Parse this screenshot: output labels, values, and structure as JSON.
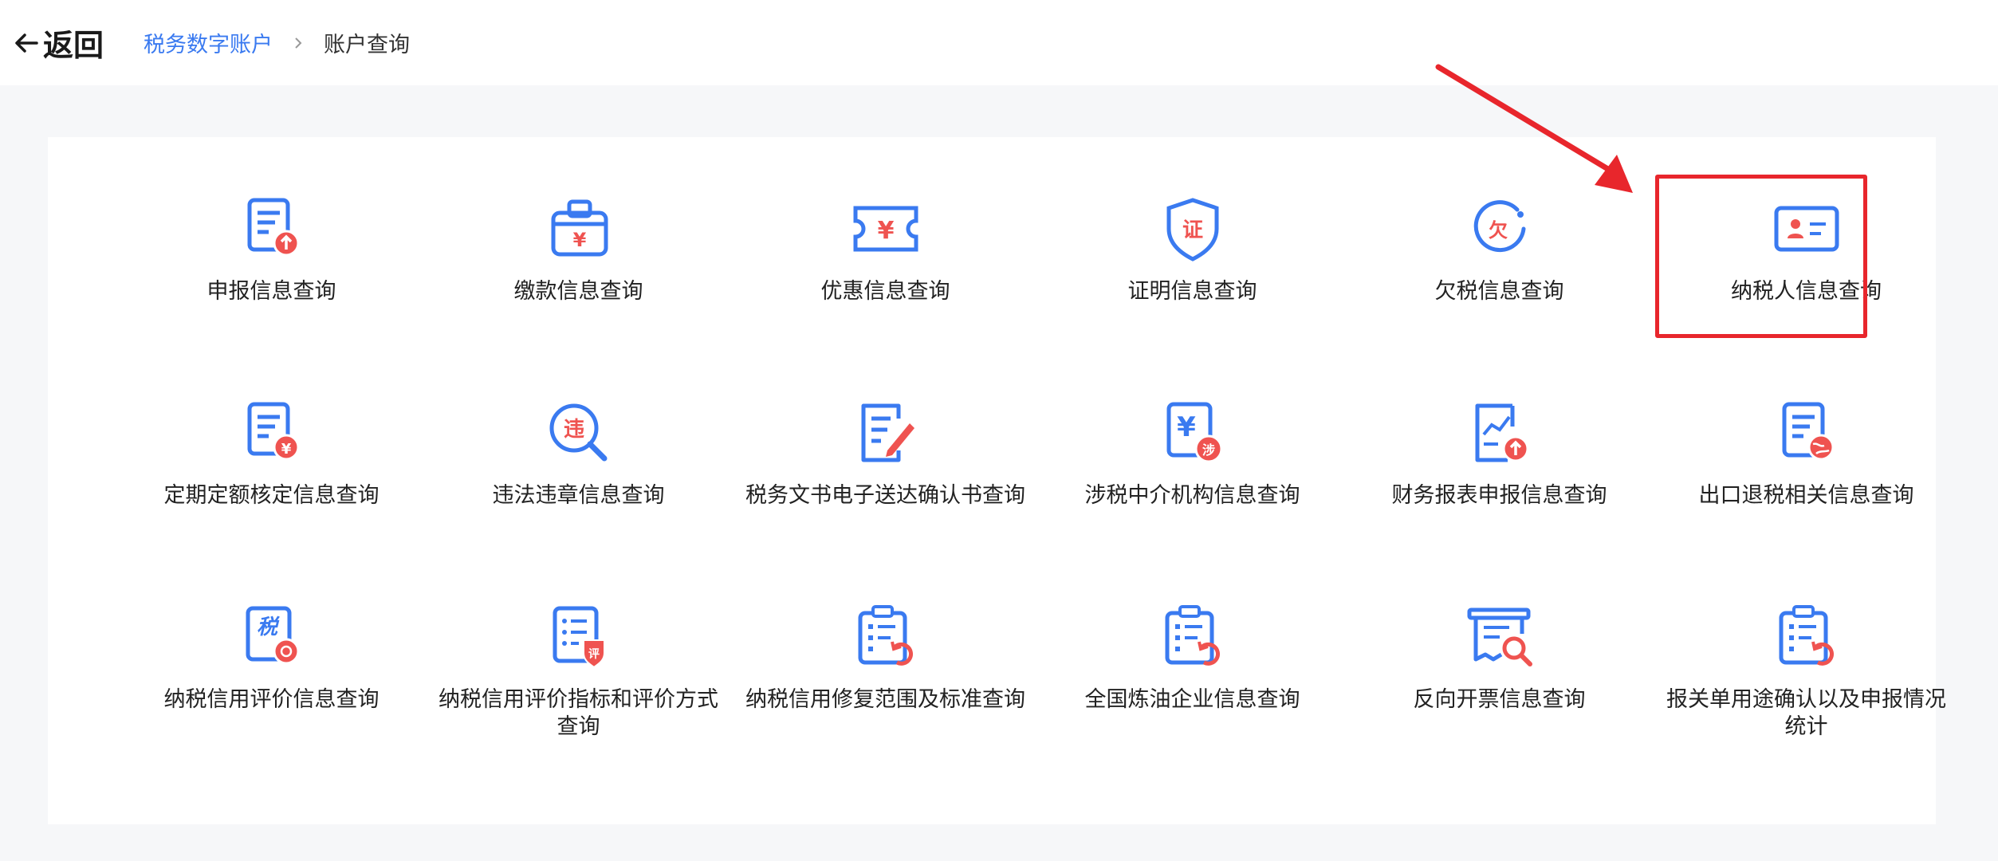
{
  "header": {
    "back_label": "返回",
    "breadcrumb": [
      {
        "label": "税务数字账户"
      },
      {
        "label": "账户查询"
      }
    ]
  },
  "colors": {
    "accent": "#3a7af0",
    "badge": "#ef5350",
    "highlight": "#e8262c"
  },
  "items": [
    {
      "label": "申报信息查询",
      "icon": "doc-upload-icon"
    },
    {
      "label": "缴款信息查询",
      "icon": "wallet-yuan-icon"
    },
    {
      "label": "优惠信息查询",
      "icon": "coupon-yuan-icon"
    },
    {
      "label": "证明信息查询",
      "icon": "certificate-shield-icon"
    },
    {
      "label": "欠税信息查询",
      "icon": "arrears-gauge-icon"
    },
    {
      "label": "纳税人信息查询",
      "icon": "id-card-icon"
    },
    {
      "label": "定期定额核定信息查询",
      "icon": "doc-yuan-icon"
    },
    {
      "label": "违法违章信息查询",
      "icon": "violation-search-icon"
    },
    {
      "label": "税务文书电子送达确认书查询",
      "icon": "doc-pen-icon"
    },
    {
      "label": "涉税中介机构信息查询",
      "icon": "agency-yuan-icon"
    },
    {
      "label": "财务报表申报信息查询",
      "icon": "report-chart-icon"
    },
    {
      "label": "出口退税相关信息查询",
      "icon": "doc-globe-icon"
    },
    {
      "label": "纳税信用评价信息查询",
      "icon": "tax-credit-icon"
    },
    {
      "label": "纳税信用评价指标和评价方式查询",
      "icon": "evaluation-doc-icon"
    },
    {
      "label": "纳税信用修复范围及标准查询",
      "icon": "clipboard-refresh-icon"
    },
    {
      "label": "全国炼油企业信息查询",
      "icon": "clipboard-refresh-icon"
    },
    {
      "label": "反向开票信息查询",
      "icon": "invoice-search-icon"
    },
    {
      "label": "报关单用途确认以及申报情况统计",
      "icon": "clipboard-refresh-icon"
    }
  ]
}
